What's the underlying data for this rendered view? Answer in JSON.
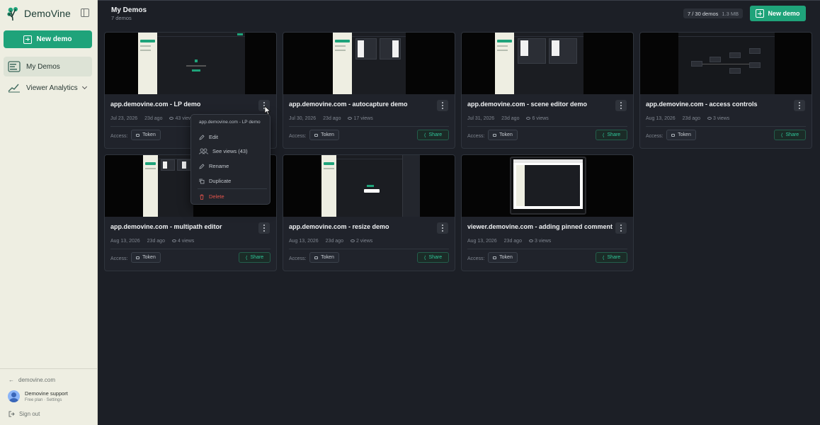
{
  "sidebar": {
    "brand": "DemoVine",
    "new_demo": "New demo",
    "items": [
      {
        "label": "My Demos"
      },
      {
        "label": "Viewer Analytics"
      }
    ],
    "footer_link": "demovine.com",
    "user": {
      "name": "Demovine support",
      "sub": "Free plan · Settings"
    },
    "sign_out": "Sign out"
  },
  "header": {
    "title": "My Demos",
    "subtitle": "7 demos",
    "quota": "7 / 30 demos",
    "storage": "1.3 MB",
    "new_demo": "New demo"
  },
  "access_label": "Access:",
  "token_label": "Token",
  "share_label": "Share",
  "cards": [
    {
      "title": "app.demovine.com - LP demo",
      "date": "Jul 23, 2026",
      "ago": "23d ago",
      "views": "43 views"
    },
    {
      "title": "app.demovine.com - autocapture demo",
      "date": "Jul 30, 2026",
      "ago": "23d ago",
      "views": "17 views"
    },
    {
      "title": "app.demovine.com - scene editor demo",
      "date": "Jul 31, 2026",
      "ago": "23d ago",
      "views": "6 views"
    },
    {
      "title": "app.demovine.com - access controls",
      "date": "Aug 13, 2026",
      "ago": "23d ago",
      "views": "3 views"
    },
    {
      "title": "app.demovine.com - multipath editor",
      "date": "Aug 13, 2026",
      "ago": "23d ago",
      "views": "4 views"
    },
    {
      "title": "app.demovine.com - resize demo",
      "date": "Aug 13, 2026",
      "ago": "23d ago",
      "views": "2 views"
    },
    {
      "title": "viewer.demovine.com - adding pinned comment",
      "date": "Aug 13, 2026",
      "ago": "23d ago",
      "views": "3 views"
    }
  ],
  "context_menu": {
    "title": "app.demovine.com - LP demo",
    "items": [
      {
        "label": "Edit",
        "icon": "pencil-icon"
      },
      {
        "label": "See views (43)",
        "icon": "users-icon"
      },
      {
        "label": "Rename",
        "icon": "pencil-icon"
      },
      {
        "label": "Duplicate",
        "icon": "copy-icon"
      },
      {
        "label": "Delete",
        "icon": "trash-icon"
      }
    ]
  },
  "colors": {
    "accent": "#1fa37a",
    "background": "#1c1f26",
    "sidebar": "#eeeee2",
    "card": "#20232b",
    "danger": "#e5534b"
  }
}
